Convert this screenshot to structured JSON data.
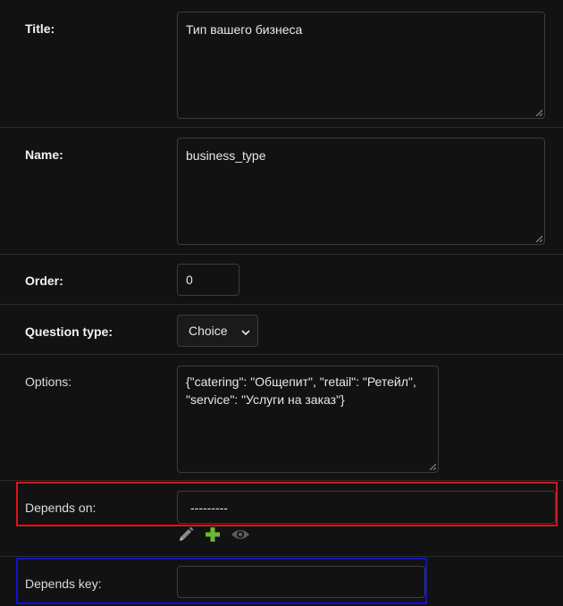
{
  "form": {
    "title": {
      "label": "Title:",
      "value": "Тип вашего бизнеса"
    },
    "name": {
      "label": "Name:",
      "value": "business_type"
    },
    "order": {
      "label": "Order:",
      "value": "0"
    },
    "question_type": {
      "label": "Question type:",
      "selected": "Choice"
    },
    "options": {
      "label": "Options:",
      "value": "{\"catering\": \"Общепит\", \"retail\": \"Ретейл\",\n\"service\": \"Услуги на заказ\"}"
    },
    "depends_on": {
      "label": "Depends on:",
      "selected": "---------",
      "actions": [
        "pencil-icon",
        "plus-icon",
        "eye-icon"
      ]
    },
    "depends_key": {
      "label": "Depends key:",
      "value": ""
    }
  },
  "colors": {
    "background": "#121212",
    "highlight_red": "#e01313",
    "highlight_blue": "#1010d8",
    "add_green": "#6ab82e"
  }
}
